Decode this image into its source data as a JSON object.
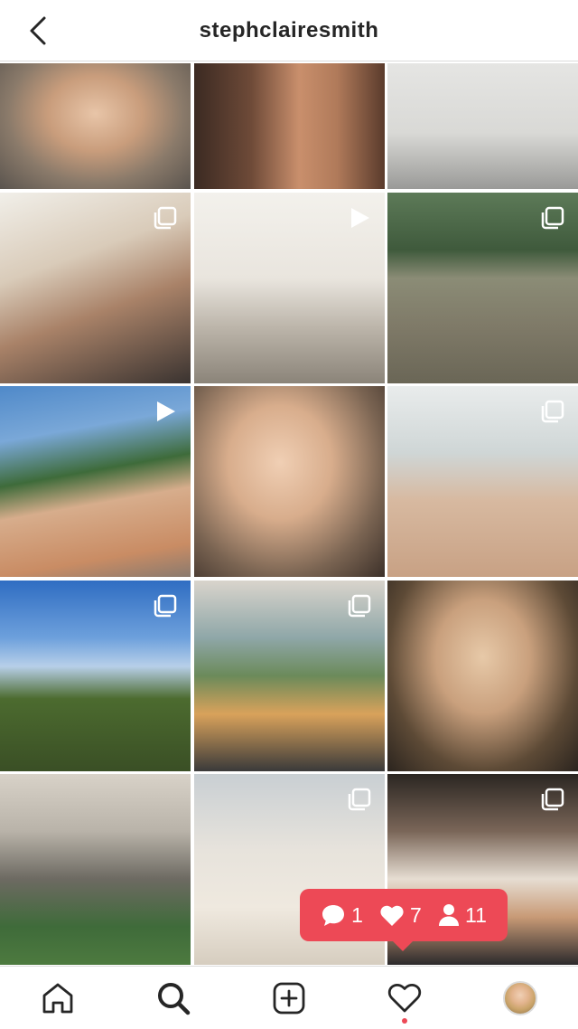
{
  "header": {
    "title": "stephclairesmith",
    "back_icon": "chevron-left-icon"
  },
  "grid": {
    "tiles": [
      {
        "name": "post-1",
        "badge": ""
      },
      {
        "name": "post-2",
        "badge": ""
      },
      {
        "name": "post-3",
        "badge": ""
      },
      {
        "name": "post-4",
        "badge": "carousel"
      },
      {
        "name": "post-5",
        "badge": "video"
      },
      {
        "name": "post-6",
        "badge": "carousel"
      },
      {
        "name": "post-7",
        "badge": "video"
      },
      {
        "name": "post-8",
        "badge": ""
      },
      {
        "name": "post-9",
        "badge": "carousel"
      },
      {
        "name": "post-10",
        "badge": "carousel"
      },
      {
        "name": "post-11",
        "badge": "carousel"
      },
      {
        "name": "post-12",
        "badge": ""
      },
      {
        "name": "post-13",
        "badge": ""
      },
      {
        "name": "post-14",
        "badge": "carousel"
      },
      {
        "name": "post-15",
        "badge": "carousel"
      }
    ]
  },
  "activity_popup": {
    "comments": "1",
    "likes": "7",
    "follows": "11",
    "color": "#ed4956"
  },
  "bottom_nav": {
    "items": [
      "home-icon",
      "search-icon",
      "new-post-icon",
      "activity-heart-icon",
      "profile-avatar"
    ],
    "active": "search-icon"
  }
}
